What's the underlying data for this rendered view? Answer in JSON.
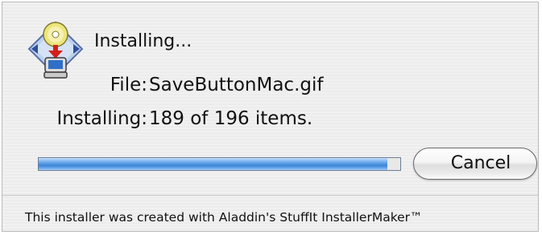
{
  "dialog": {
    "heading": "Installing...",
    "file_label": "File:",
    "file_name": "SaveButtonMac.gif",
    "count_label": "Installing:",
    "count_text": "189 of  196 items.",
    "items_done": 189,
    "items_total": 196,
    "progress_fraction": 0.964,
    "cancel_label": "Cancel",
    "footer": "This installer was created with Aladdin's StuffIt InstallerMaker™"
  },
  "icon": "installer-disc-computer-icon",
  "colors": {
    "progress_fill": "#4f95e2",
    "window_background": "#eeeeee"
  }
}
